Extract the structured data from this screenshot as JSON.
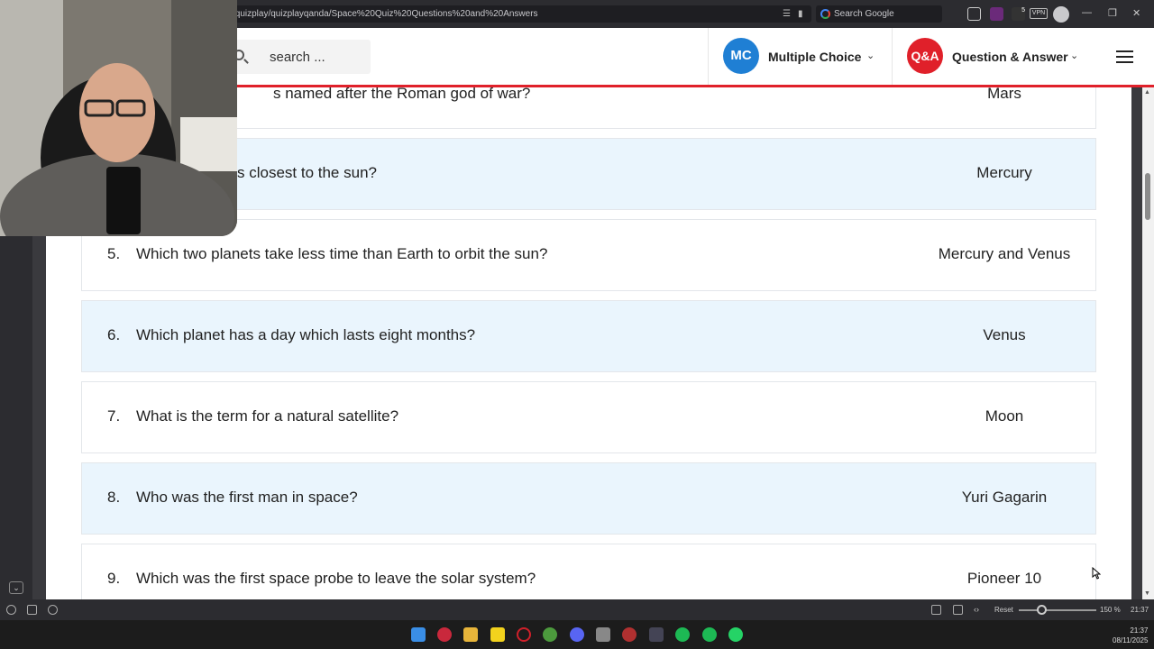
{
  "browser": {
    "url": "/quizplay/quizplayqanda/Space%20Quiz%20Questions%20and%20Answers",
    "search_placeholder": "Search Google",
    "vpn_label": "VPN",
    "badge_count": "5"
  },
  "site": {
    "search_placeholder": "search ...",
    "nav": [
      {
        "badge": "MC",
        "label": "Multiple Choice",
        "color": "#1f7fd4"
      },
      {
        "badge": "Q&A",
        "label": "Question & Answer",
        "color": "#e0202a"
      }
    ],
    "accent": "#e0202a"
  },
  "quiz": {
    "rows": [
      {
        "num": "",
        "question": "s named after the Roman god of war?",
        "answer": "Mars"
      },
      {
        "num": "",
        "question": "s closest to the sun?",
        "answer": "Mercury"
      },
      {
        "num": "5.",
        "question": "Which two planets take less time than Earth to orbit the sun?",
        "answer": "Mercury and Venus"
      },
      {
        "num": "6.",
        "question": "Which planet has a day which lasts eight months?",
        "answer": "Venus"
      },
      {
        "num": "7.",
        "question": "What is the term for a natural satellite?",
        "answer": "Moon"
      },
      {
        "num": "8.",
        "question": "Who was the first man in space?",
        "answer": "Yuri Gagarin"
      },
      {
        "num": "9.",
        "question": "Which was the first space probe to leave the solar system?",
        "answer": "Pioneer 10"
      }
    ]
  },
  "statusbar": {
    "reset_label": "Reset",
    "zoom": "150 %",
    "time": "21:37"
  },
  "taskbar": {
    "time": "21:37",
    "date": "08/11/2025"
  }
}
